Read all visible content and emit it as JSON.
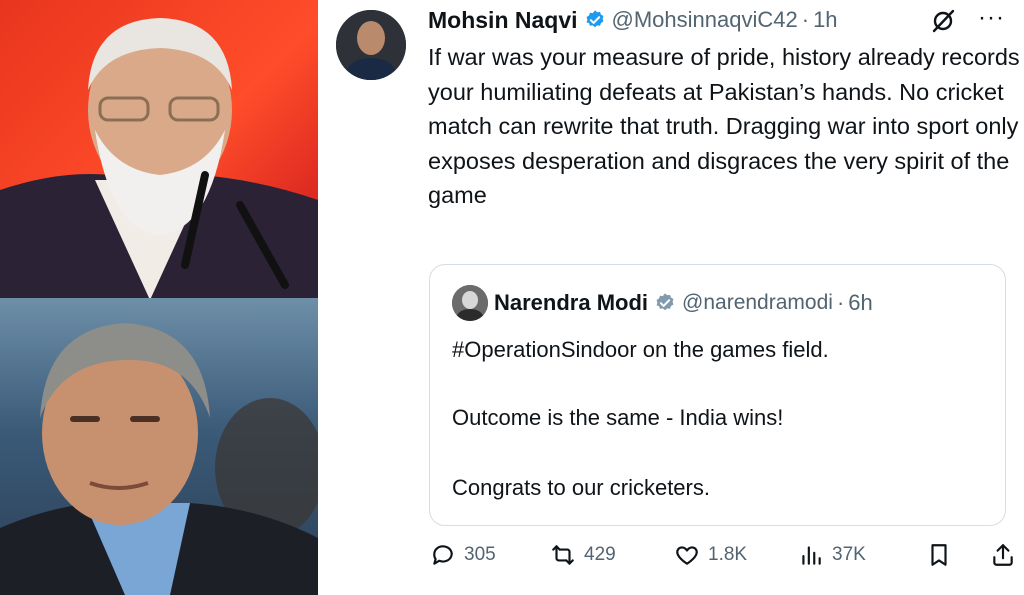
{
  "photos": {
    "top": {
      "subject": "speaker-at-microphone-photo"
    },
    "bottom": {
      "subject": "man-in-suit-portrait-photo"
    }
  },
  "tweet": {
    "author_name": "Mohsin Naqvi",
    "author_handle": "@MohsinnaqviC42",
    "separator": "·",
    "time": "1h",
    "more": "···",
    "body": "If war was your measure of pride, history already records your humiliating defeats at Pakistan’s hands. No cricket match can rewrite that truth. Dragging war into sport only exposes desperation and disgraces the very spirit of the game",
    "verified_color": "#1d9bf0",
    "quote": {
      "author_name": "Narendra Modi",
      "author_handle": "@narendramodi",
      "separator": "·",
      "time": "6h",
      "verified_color": "#829aab",
      "lines": [
        "#OperationSindoor on the games field.",
        "Outcome is the same - India wins!",
        "Congrats to our cricketers."
      ]
    },
    "actions": {
      "replies": "305",
      "reposts": "429",
      "likes": "1.8K",
      "views": "37K"
    }
  }
}
